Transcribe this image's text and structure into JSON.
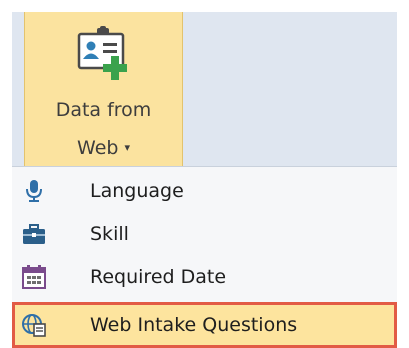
{
  "ribbon": {
    "button": {
      "label_line1": "Data from",
      "label_line2": "Web",
      "caret": "▾",
      "icon": "id-card-add-icon"
    }
  },
  "menu": {
    "items": [
      {
        "label": "Language",
        "icon": "microphone-icon"
      },
      {
        "label": "Skill",
        "icon": "toolbox-icon"
      },
      {
        "label": "Required Date",
        "icon": "calendar-icon"
      },
      {
        "label": "Web Intake Questions",
        "icon": "globe-document-icon",
        "highlighted": true
      }
    ]
  },
  "colors": {
    "ribbon_bg": "#dfe6f0",
    "button_active": "#fbe39f",
    "highlight_border": "#e25b45",
    "menu_bg": "#f6f7f9"
  }
}
